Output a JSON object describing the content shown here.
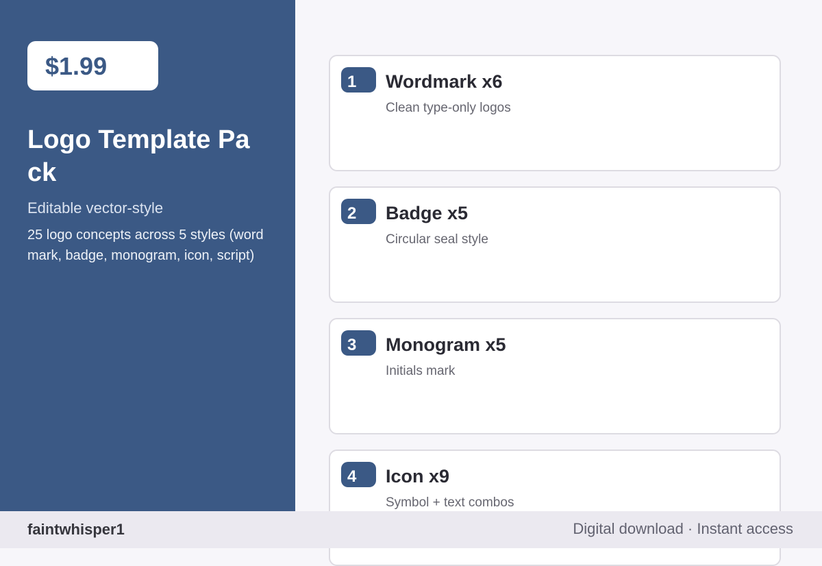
{
  "product": {
    "price": "$1.99",
    "title": "Logo Template Pack",
    "subtitle": "Editable vector-style",
    "description": "25 logo concepts across 5 styles (wordmark, badge, monogram, icon, script)"
  },
  "items": [
    {
      "number": "1",
      "title": "Wordmark x6",
      "description": "Clean type-only logos"
    },
    {
      "number": "2",
      "title": "Badge x5",
      "description": "Circular seal style"
    },
    {
      "number": "3",
      "title": "Monogram x5",
      "description": "Initials mark"
    },
    {
      "number": "4",
      "title": "Icon x9",
      "description": "Symbol + text combos"
    }
  ],
  "footer": {
    "author": "faintwhisper1",
    "meta": "Digital download · Instant access"
  },
  "colors": {
    "accent": "#3b5985",
    "page_background": "#f7f6fa",
    "footer_background": "#ebe9f0",
    "card_background": "#ffffff"
  }
}
